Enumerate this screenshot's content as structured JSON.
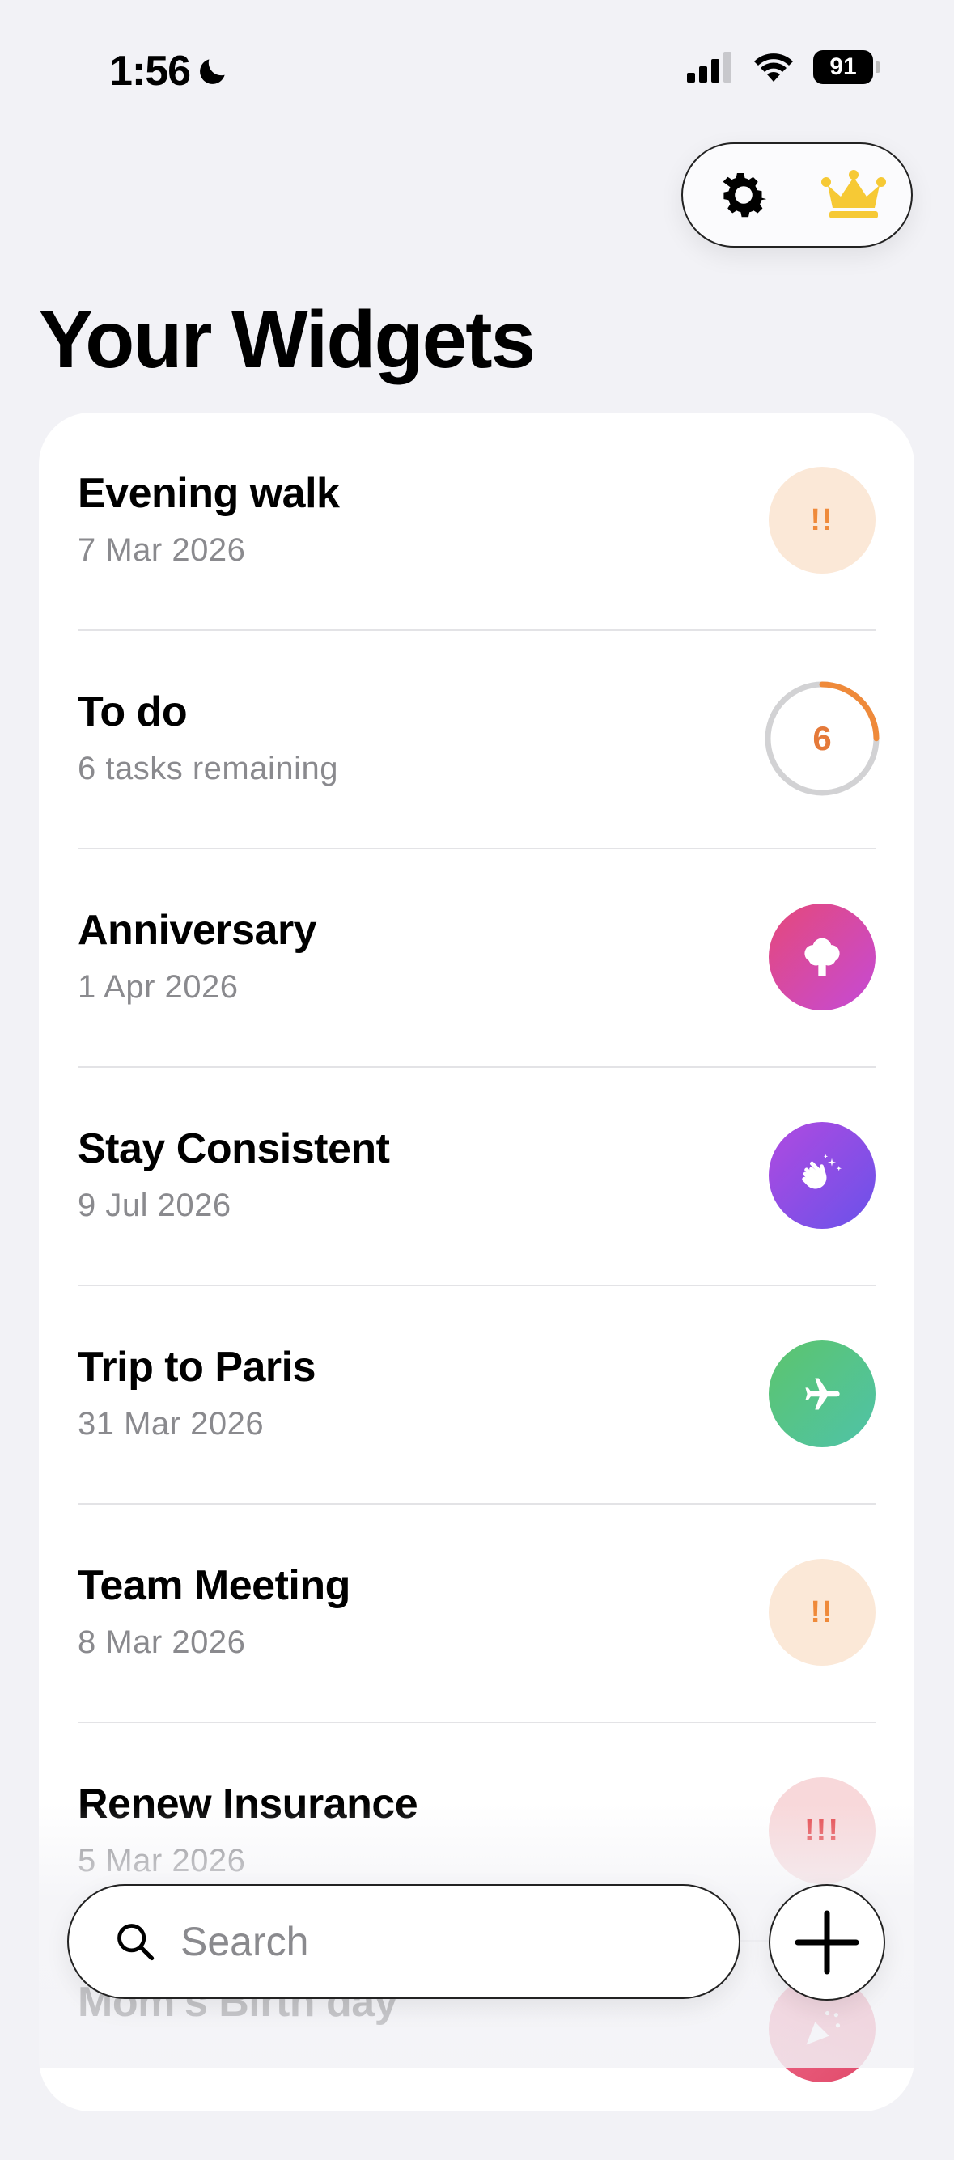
{
  "status_bar": {
    "time": "1:56",
    "battery": "91"
  },
  "header": {
    "title": "Your Widgets",
    "settings_icon": "gear-icon",
    "premium_icon": "crown-icon"
  },
  "widgets": [
    {
      "title": "Evening walk",
      "subtitle": "7 Mar 2026",
      "badge": "!!",
      "badge_bg": "#fbe8d7",
      "badge_color": "#ef8a3a"
    },
    {
      "title": "To do",
      "subtitle": "6 tasks remaining",
      "badge": "6",
      "progress_color": "#ef8a3a"
    },
    {
      "title": "Anniversary",
      "subtitle": "1 Apr 2026",
      "icon": "tree-icon",
      "gradient": [
        "#e5497a",
        "#c54ad6"
      ]
    },
    {
      "title": "Stay Consistent",
      "subtitle": "9 Jul 2026",
      "icon": "clapping-hands-icon",
      "gradient": [
        "#b04ae0",
        "#6a52ea"
      ]
    },
    {
      "title": "Trip to Paris",
      "subtitle": "31 Mar 2026",
      "icon": "airplane-icon",
      "gradient": [
        "#5cc46d",
        "#4fc3a8"
      ]
    },
    {
      "title": "Team Meeting",
      "subtitle": "8 Mar 2026",
      "badge": "!!",
      "badge_bg": "#fbe8d7",
      "badge_color": "#ef8a3a"
    },
    {
      "title": "Renew Insurance",
      "subtitle": "5 Mar 2026",
      "badge": "!!!",
      "badge_bg": "#f8d8da",
      "badge_color": "#e5484d"
    },
    {
      "title": "Mom’s Birth day",
      "icon": "party-popper-icon"
    }
  ],
  "search": {
    "placeholder": "Search"
  },
  "colors": {
    "crown": "#f6c935",
    "background": "#f2f2f6"
  }
}
